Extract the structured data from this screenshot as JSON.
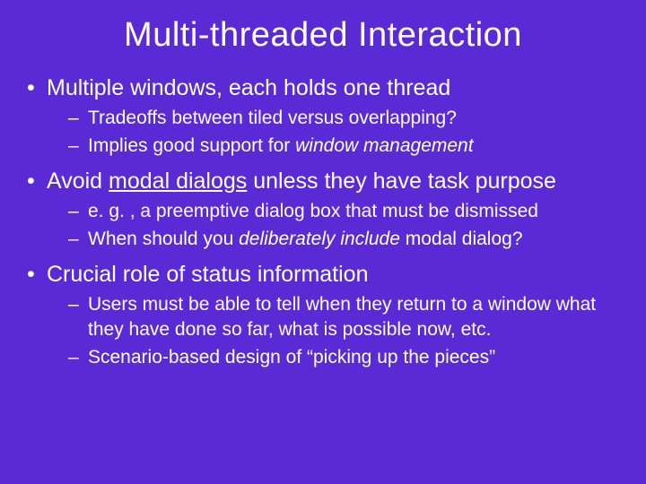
{
  "title": "Multi-threaded Interaction",
  "b1": {
    "text": "Multiple windows, each holds one thread",
    "s1": "Tradeoffs between tiled versus overlapping?",
    "s2_a": "Implies good support for ",
    "s2_b": "window management"
  },
  "b2": {
    "text_a": "Avoid ",
    "text_b": "modal dialogs",
    "text_c": " unless they have task purpose",
    "s1": "e. g. , a preemptive dialog box that must be dismissed",
    "s2_a": "When should you ",
    "s2_b": "deliberately include",
    "s2_c": " modal dialog?"
  },
  "b3": {
    "text": "Crucial role of status information",
    "s1": "Users must be able to tell when they return to a window what they have done so far, what is possible now, etc.",
    "s2": "Scenario-based design of “picking up the pieces”"
  }
}
